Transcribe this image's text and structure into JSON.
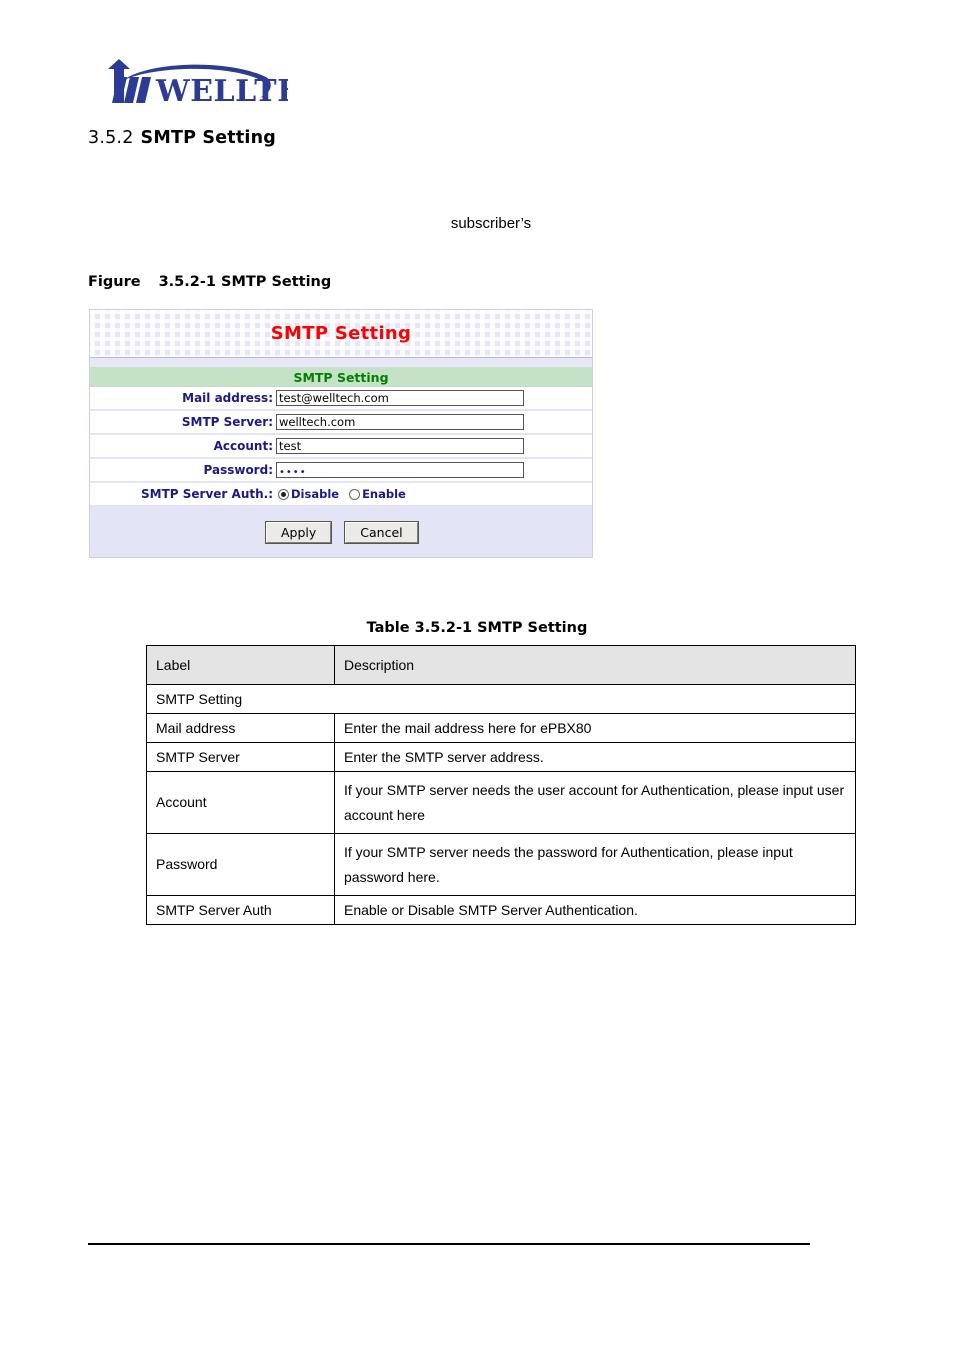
{
  "logo": {
    "brand": "WELLTECH",
    "color": "#2c3c96",
    "icon": "welltech-logo"
  },
  "heading": {
    "number": "3.5.2",
    "title": "SMTP Setting"
  },
  "body_fragment": "subscriber’s",
  "figure": {
    "prefix": "Figure",
    "caption": "3.5.2-1 SMTP Setting"
  },
  "panel": {
    "title": "SMTP Setting",
    "title_color": "#ff0000",
    "section_band": "SMTP Setting",
    "section_band_color": "#008000",
    "fields": [
      {
        "label": "Mail address:",
        "value": "test@welltech.com",
        "type": "text"
      },
      {
        "label": "SMTP Server:",
        "value": "welltech.com",
        "type": "text"
      },
      {
        "label": "Account:",
        "value": "test",
        "type": "text"
      },
      {
        "label": "Password:",
        "value": "••••",
        "type": "password"
      }
    ],
    "auth": {
      "label": "SMTP Server Auth.:",
      "options": [
        {
          "label": "Disable",
          "selected": true
        },
        {
          "label": "Enable",
          "selected": false
        }
      ]
    },
    "buttons": {
      "apply": "Apply",
      "cancel": "Cancel"
    }
  },
  "table": {
    "caption": "Table 3.5.2-1 SMTP Setting",
    "headers": [
      "Label",
      "Description"
    ],
    "group_label": "SMTP Setting",
    "rows": [
      {
        "label": "Mail address",
        "description": "Enter the mail address here for ePBX80"
      },
      {
        "label": "SMTP Server",
        "description": "Enter the SMTP server address."
      },
      {
        "label": "Account",
        "description": "If your SMTP server needs the user account for Authentication, please input user account here"
      },
      {
        "label": "Password",
        "description": "If your SMTP server needs the password for Authentication, please input password here."
      },
      {
        "label": "SMTP Server Auth",
        "description": "Enable or Disable SMTP Server Authentication."
      }
    ]
  }
}
